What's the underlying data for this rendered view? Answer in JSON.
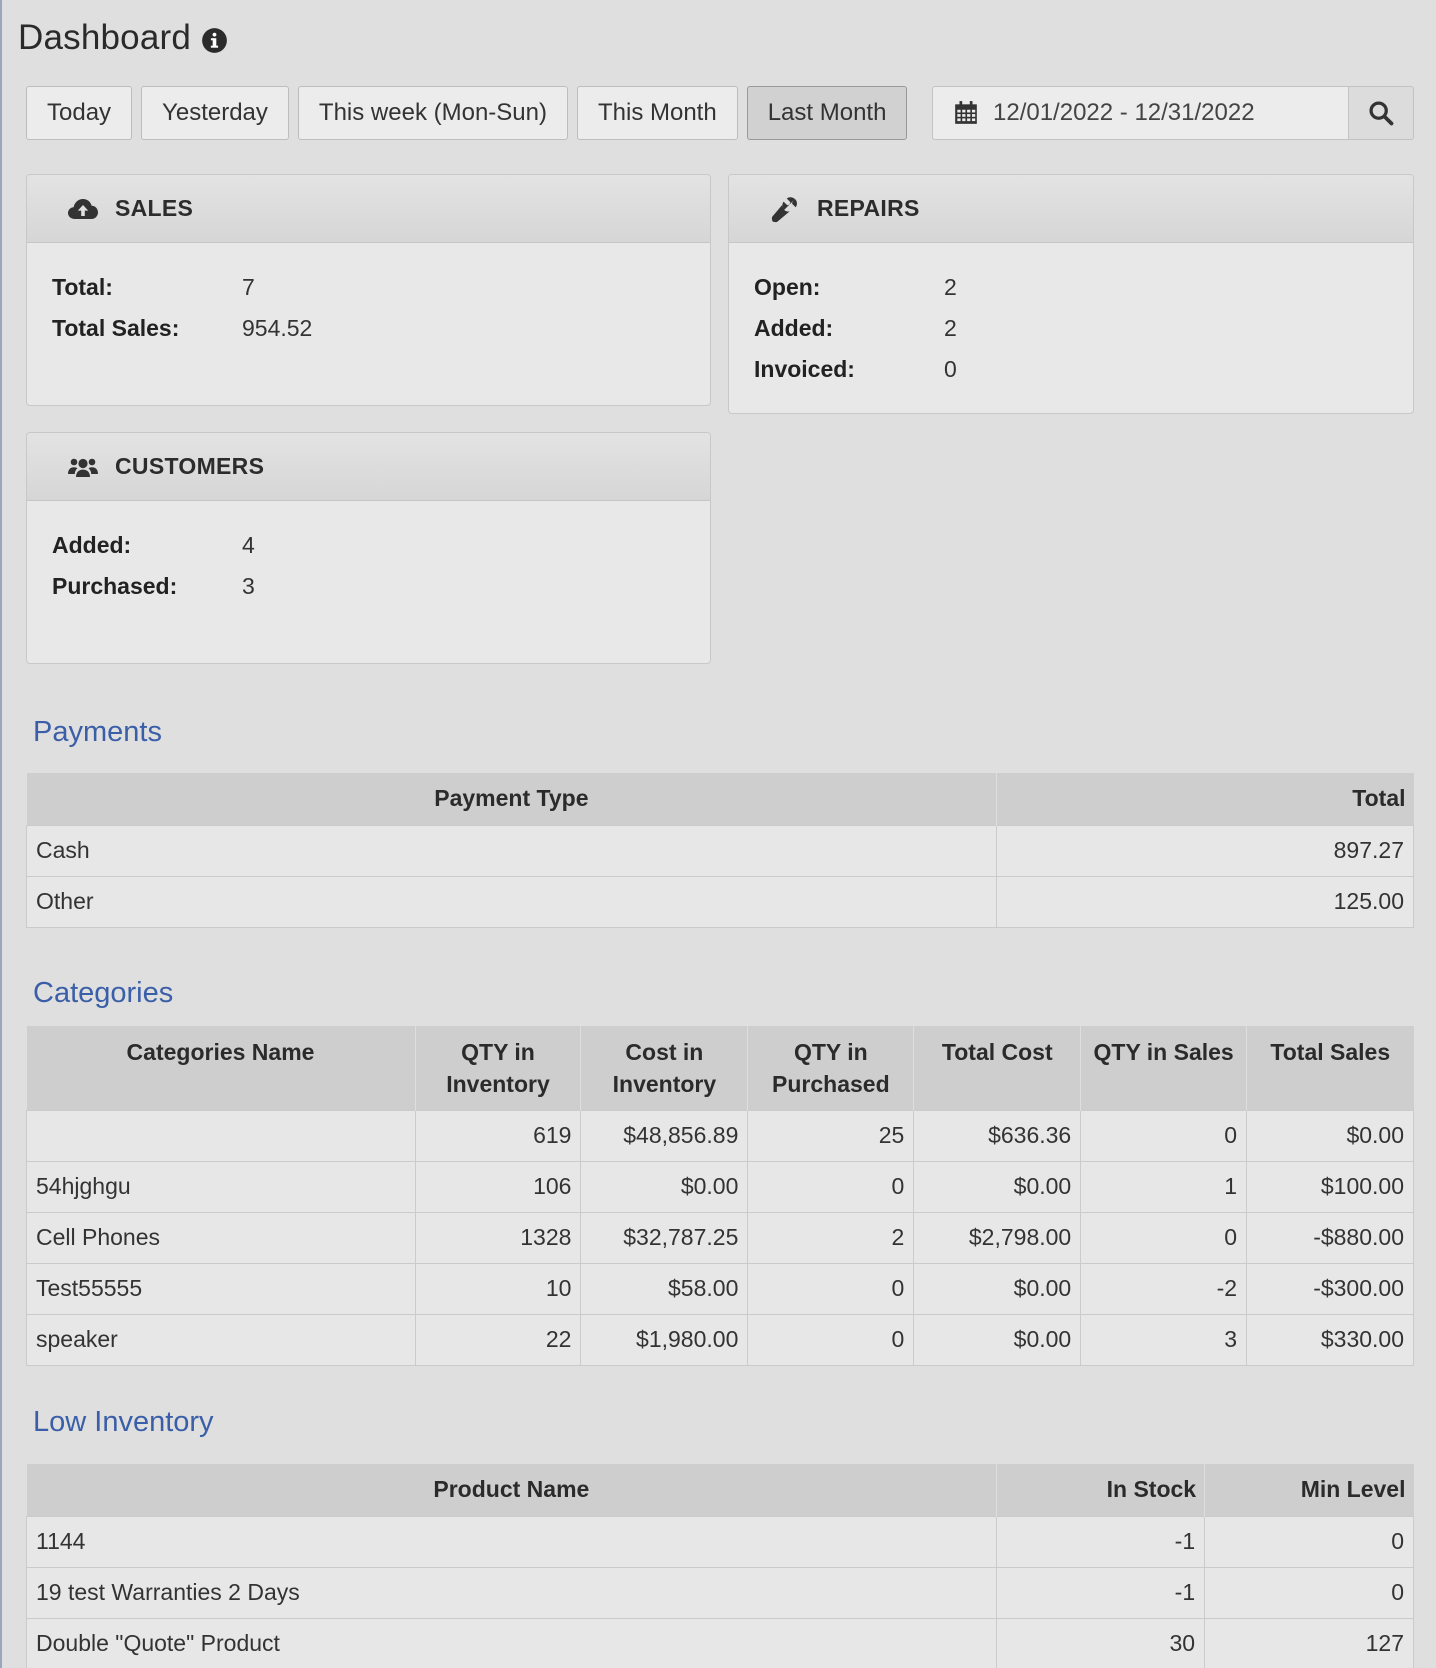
{
  "page": {
    "title": "Dashboard"
  },
  "filters": {
    "buttons": [
      "Today",
      "Yesterday",
      "This week (Mon-Sun)",
      "This Month",
      "Last Month"
    ],
    "active": "Last Month",
    "date_range": "12/01/2022 - 12/31/2022"
  },
  "sales": {
    "title": "SALES",
    "rows": [
      {
        "label": "Total:",
        "value": "7"
      },
      {
        "label": "Total Sales:",
        "value": "954.52"
      }
    ]
  },
  "repairs": {
    "title": "REPAIRS",
    "rows": [
      {
        "label": "Open:",
        "value": "2"
      },
      {
        "label": "Added:",
        "value": "2"
      },
      {
        "label": "Invoiced:",
        "value": "0"
      }
    ]
  },
  "customers": {
    "title": "CUSTOMERS",
    "rows": [
      {
        "label": "Added:",
        "value": "4"
      },
      {
        "label": "Purchased:",
        "value": "3"
      }
    ]
  },
  "payments": {
    "title": "Payments",
    "headers": [
      "Payment Type",
      "Total"
    ],
    "rows": [
      [
        "Cash",
        "897.27"
      ],
      [
        "Other",
        "125.00"
      ]
    ]
  },
  "categories": {
    "title": "Categories",
    "headers": [
      [
        "Categories Name"
      ],
      [
        "QTY in",
        "Inventory"
      ],
      [
        "Cost in",
        "Inventory"
      ],
      [
        "QTY in",
        "Purchased"
      ],
      [
        "Total Cost"
      ],
      [
        "QTY in Sales"
      ],
      [
        "Total Sales"
      ]
    ],
    "rows": [
      [
        "",
        "619",
        "$48,856.89",
        "25",
        "$636.36",
        "0",
        "$0.00"
      ],
      [
        "54hjghgu",
        "106",
        "$0.00",
        "0",
        "$0.00",
        "1",
        "$100.00"
      ],
      [
        "Cell Phones",
        "1328",
        "$32,787.25",
        "2",
        "$2,798.00",
        "0",
        "-$880.00"
      ],
      [
        "Test55555",
        "10",
        "$58.00",
        "0",
        "$0.00",
        "-2",
        "-$300.00"
      ],
      [
        "speaker",
        "22",
        "$1,980.00",
        "0",
        "$0.00",
        "3",
        "$330.00"
      ]
    ]
  },
  "low_inventory": {
    "title": "Low Inventory",
    "headers": [
      "Product Name",
      "In Stock",
      "Min Level"
    ],
    "rows": [
      [
        "1144",
        "-1",
        "0"
      ],
      [
        "19 test Warranties 2 Days",
        "-1",
        "0"
      ],
      [
        "Double \"Quote\" Product",
        "30",
        "127"
      ]
    ]
  }
}
